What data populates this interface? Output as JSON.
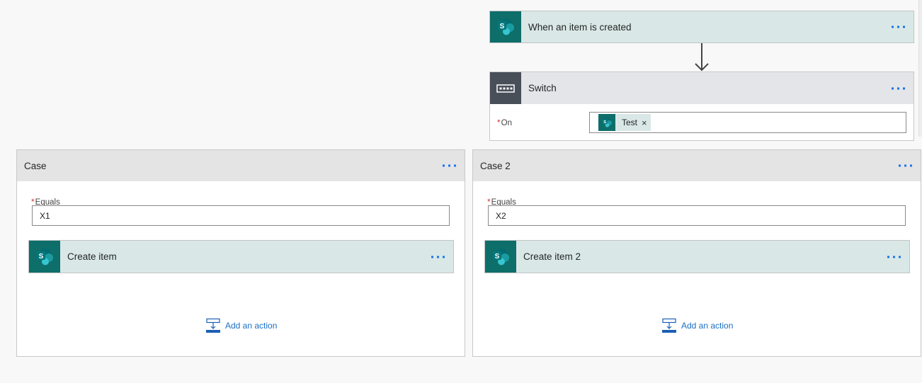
{
  "trigger": {
    "title": "When an item is created",
    "icon": "sharepoint-icon",
    "more_icon": "more-ellipsis-icon"
  },
  "switch": {
    "title": "Switch",
    "icon": "switch-control-icon",
    "more_icon": "more-ellipsis-icon",
    "on_label": "On",
    "required_marker": "*",
    "on_token": {
      "label": "Test",
      "icon": "sharepoint-icon",
      "remove_glyph": "×"
    }
  },
  "cases": [
    {
      "title": "Case",
      "equals_label": "Equals",
      "required_marker": "*",
      "equals_value": "X1",
      "action": {
        "title": "Create item",
        "icon": "sharepoint-icon"
      },
      "add_action_label": "Add an action"
    },
    {
      "title": "Case 2",
      "equals_label": "Equals",
      "required_marker": "*",
      "equals_value": "X2",
      "action": {
        "title": "Create item 2",
        "icon": "sharepoint-icon"
      },
      "add_action_label": "Add an action"
    }
  ],
  "colors": {
    "sharepoint_teal": "#0d6e6a",
    "control_dark": "#484f58",
    "link_blue": "#1a6fc4",
    "required_red": "#d13438"
  }
}
